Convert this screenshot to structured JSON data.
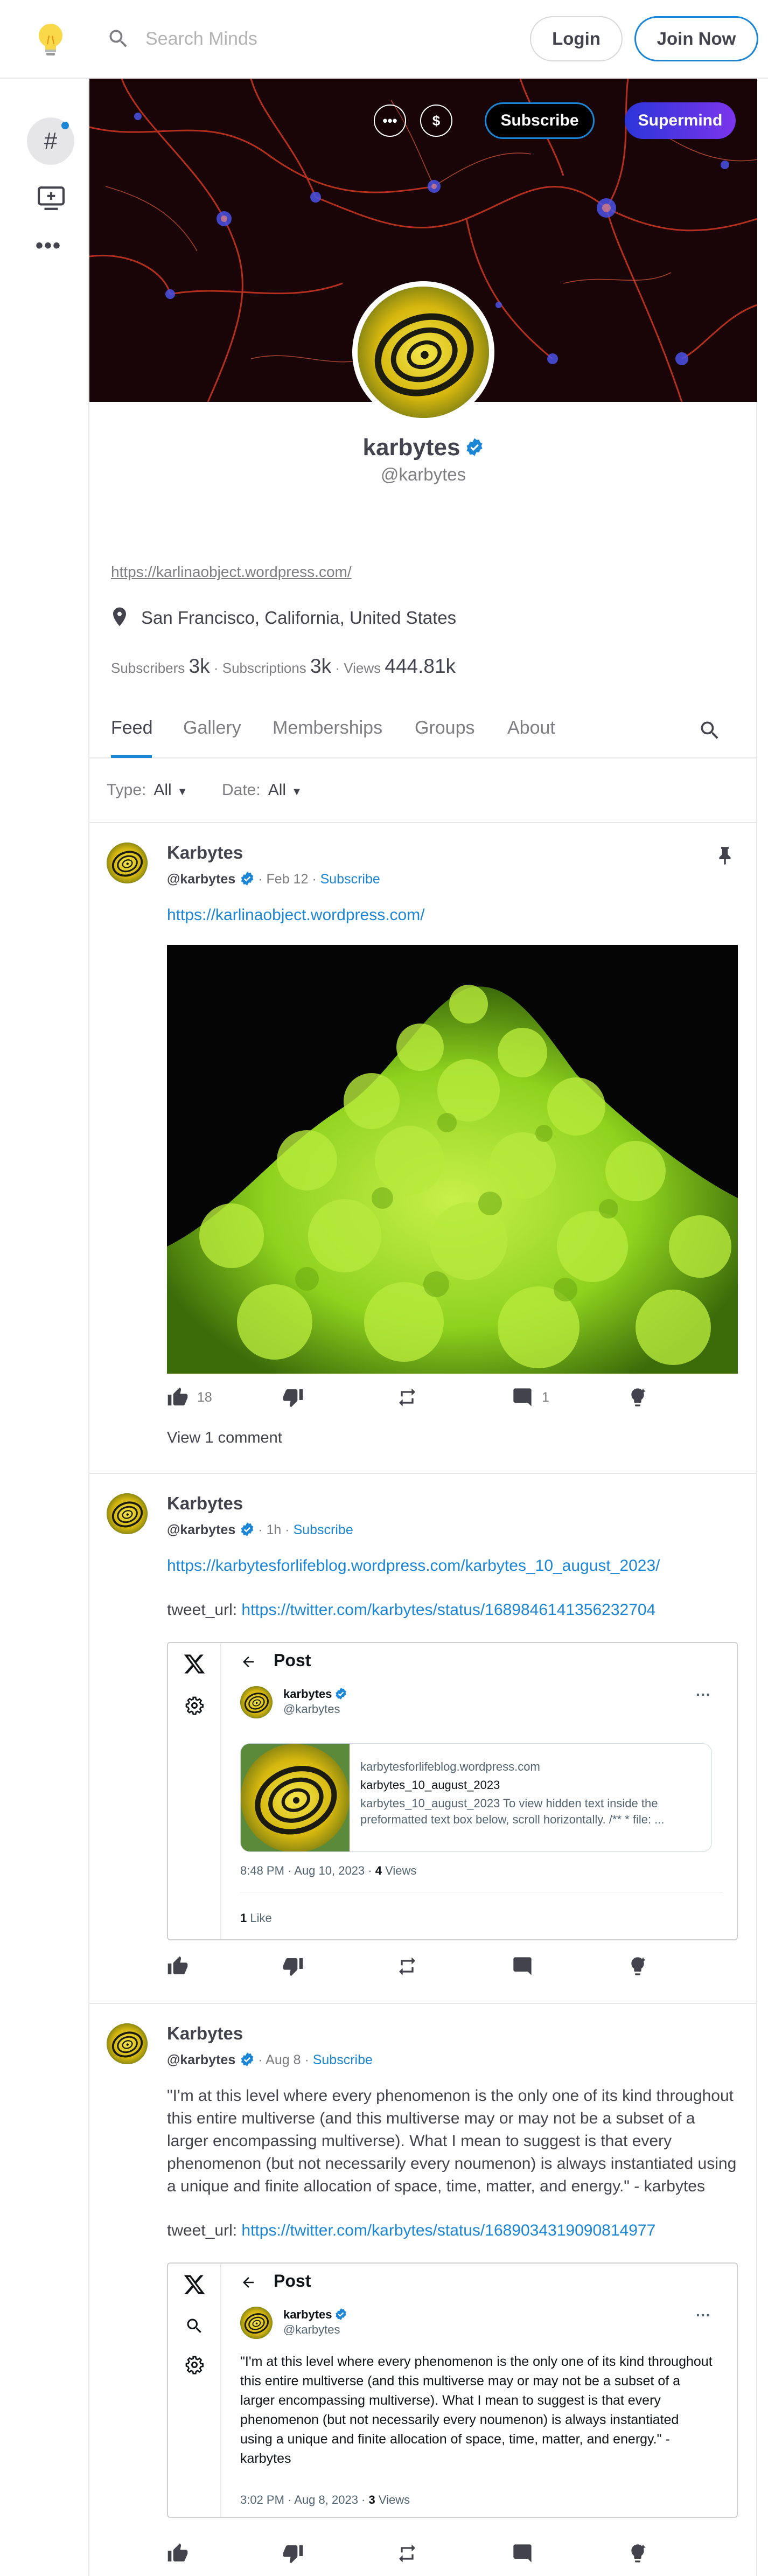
{
  "header": {
    "search_placeholder": "Search Minds",
    "login_label": "Login",
    "join_label": "Join Now"
  },
  "sidebar": {
    "items": [
      "newsfeed-hash-icon",
      "boost-console-icon",
      "more-icon"
    ],
    "hash_glyph": "#",
    "more_glyph": "•••"
  },
  "channel": {
    "banner_buttons": {
      "more": "•••",
      "tip": "$",
      "subscribe": "Subscribe",
      "supermind": "Supermind"
    },
    "name": "karbytes",
    "handle": "@karbytes",
    "website": "https://karlinaobject.wordpress.com/",
    "location": "San Francisco, California, United States",
    "stats": {
      "subscribers_label": "Subscribers",
      "subscribers": "3k",
      "subscriptions_label": "Subscriptions",
      "subscriptions": "3k",
      "views_label": "Views",
      "views": "444.81k",
      "sep": "·"
    }
  },
  "tabs": [
    "Feed",
    "Gallery",
    "Memberships",
    "Groups",
    "About"
  ],
  "filters": {
    "type_label": "Type:",
    "type_value": "All",
    "date_label": "Date:",
    "date_value": "All"
  },
  "posts": [
    {
      "name": "Karbytes",
      "handle": "@karbytes",
      "time": "Feb 12",
      "subscribe": "Subscribe",
      "dot": "·",
      "link": "https://karlinaobject.wordpress.com/",
      "up_count": "18",
      "comment_count": "1",
      "view_comments": "View 1 comment"
    },
    {
      "name": "Karbytes",
      "handle": "@karbytes",
      "time": "1h",
      "subscribe": "Subscribe",
      "dot": "·",
      "link": "https://karbytesforlifeblog.wordpress.com/karbytes_10_august_2023/",
      "tweet_label": "tweet_url:",
      "tweet_url": "https://twitter.com/karbytes/status/1689846141356232704",
      "embed": {
        "title": "Post",
        "author": "karbytes",
        "author_handle": "@karbytes",
        "more": "···",
        "card_domain": "karbytesforlifeblog.wordpress.com",
        "card_title": "karbytes_10_august_2023",
        "card_desc": "karbytes_10_august_2023 To view hidden text inside the preformatted text box below, scroll horizontally. /** * file: ...",
        "time": "8:48 PM · Aug 10, 2023 · ",
        "views_count": "4",
        "views_label": " Views",
        "likes_count": "1",
        "likes_label": " Like"
      }
    },
    {
      "name": "Karbytes",
      "handle": "@karbytes",
      "time": "Aug 8",
      "subscribe": "Subscribe",
      "dot": "·",
      "body": "\"I'm at this level where every phenomenon is the only one of its kind throughout this entire multiverse (and this multiverse may or may not be a subset of a larger encompassing multiverse). What I mean to suggest is that every phenomenon (but not necessarily every noumenon) is always instantiated using a unique and finite allocation of space, time, matter, and energy.\" - karbytes",
      "tweet_label": "tweet_url:",
      "tweet_url": "https://twitter.com/karbytes/status/1689034319090814977",
      "embed": {
        "title": "Post",
        "author": "karbytes",
        "author_handle": "@karbytes",
        "more": "···",
        "quote": "\"I'm at this level where every phenomenon is the only one of its kind throughout this entire multiverse (and this multiverse may or may not be a subset of a larger encompassing multiverse). What I mean to suggest is that every phenomenon (but not necessarily every noumenon) is always instantiated using a unique and finite allocation of space, time, matter, and energy.\" - karbytes",
        "time": "3:02 PM · Aug 8, 2023 · ",
        "views_count": "3",
        "views_label": " Views"
      }
    }
  ],
  "colors": {
    "accent": "#1b85d6",
    "text": "#43434d",
    "muted": "#7d7d82",
    "supermind_start": "#2c35d8",
    "supermind_end": "#7b35ec"
  }
}
